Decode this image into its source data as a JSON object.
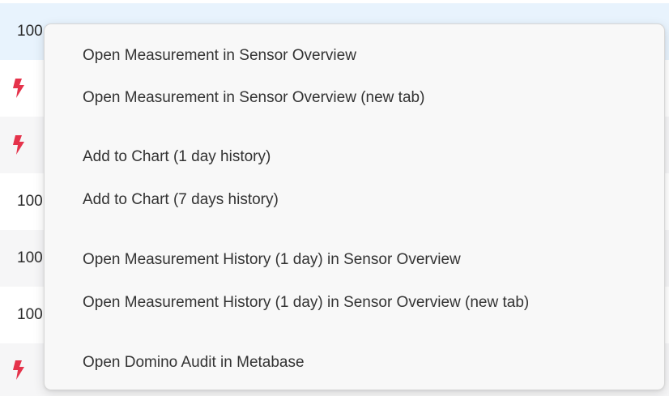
{
  "table": {
    "rows": [
      {
        "type": "text",
        "text": "100"
      },
      {
        "type": "icon",
        "icon": "lightning-bolt-icon"
      },
      {
        "type": "icon",
        "icon": "lightning-bolt-icon"
      },
      {
        "type": "text",
        "text": "100"
      },
      {
        "type": "text",
        "text": "100"
      },
      {
        "type": "text",
        "text": "100"
      },
      {
        "type": "icon",
        "icon": "lightning-bolt-icon"
      }
    ],
    "bolt_color": "#e5334b",
    "selected_row_color": "#e8f3fd"
  },
  "context_menu": {
    "items": [
      {
        "label": "Open Measurement in Sensor Overview"
      },
      {
        "label": "Open Measurement in Sensor Overview (new tab)"
      },
      {
        "label": "Add to Chart (1 day history)"
      },
      {
        "label": "Add to Chart (7 days history)"
      },
      {
        "label": "Open Measurement History (1 day) in Sensor Overview"
      },
      {
        "label": "Open Measurement History (1 day) in Sensor Overview (new tab)"
      },
      {
        "label": "Open Domino Audit in Metabase"
      }
    ]
  }
}
